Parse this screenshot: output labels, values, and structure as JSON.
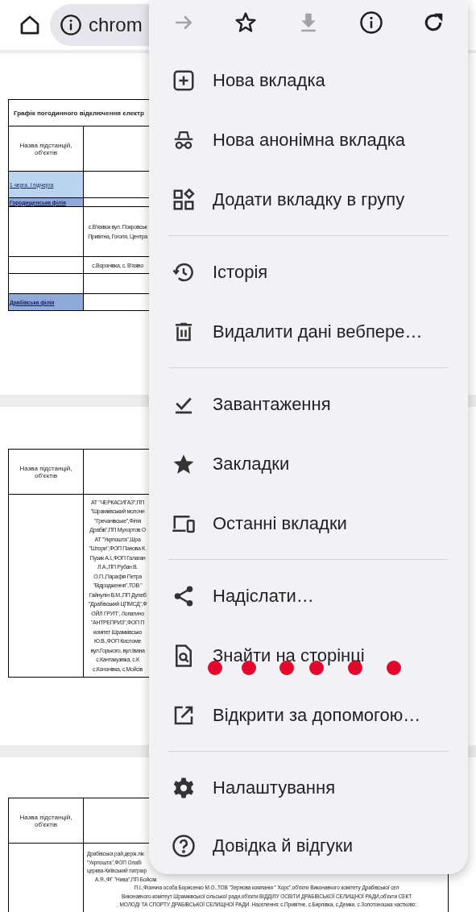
{
  "toolbar": {
    "address": "chrom"
  },
  "pages": [
    {
      "title": "Графік погодинного відключення електр",
      "header": "Назва підстанцій, об'єктів",
      "rows": [
        {
          "kind": "group",
          "label": "1 черга. І підчерга",
          "lines": []
        },
        {
          "kind": "branch",
          "label": "Городищенська філія",
          "lines": []
        },
        {
          "kind": "plain",
          "label": "",
          "lines": [
            "с.В'язівок вул. Покровськ",
            "Привітна, Гоголя, Центра"
          ]
        },
        {
          "kind": "plain",
          "label": "",
          "lines": [
            "с.Воронівка, с. В'язіво"
          ]
        },
        {
          "kind": "plain",
          "label": "",
          "lines": []
        },
        {
          "kind": "branch",
          "label": "Драбівська філія",
          "lines": []
        }
      ]
    },
    {
      "header": "Назва підстанцій, об'єктів",
      "rows": [
        {
          "kind": "plain",
          "label": "",
          "lines": [
            "АТ \"ЧЕРКАСИГАЗ\",ПП",
            "\"Шрамківський молочн",
            "\"Гречанівське\",Філія",
            "Драбів\",ПП Мухортов О",
            "АТ \"Укрпошта\",Шра",
            "\"Штори\",ФОП Панова К.",
            "Пузик А.І.,ФОП Галаган",
            "Л.А.,ПП Рубан В.",
            "О.П.,Парафія Петра",
            "\"Відродження\",ТОВ \"",
            "Гайнулін В.М.,ПП Дулеб",
            "\"Драбівський ЦПМСД\",Ф",
            "ОЙЛ ГРУП\", Лопатино",
            "\"АНТРЕПРИЗ\",ФОП П",
            "комітет Шрамківсько",
            "Ю.В.,ФОП Кисломе",
            "вул.Горького, вул.Івана",
            "с.Кантакузівка, с.К",
            "с.Кононівка, с.Мойсів"
          ]
        }
      ]
    },
    {
      "header": "Назва підстанцій, об'єктів",
      "rows": [
        {
          "kind": "wide",
          "label": "",
          "lines": [
            "Драбівська рай.держ.лік",
            "\"Укрпошта\",ФОП Олабі",
            "церква-Київський патріар",
            "А.Я.,ФГ \"Нива\",ПП Бойсак",
            "П.І.,Фізична особа Борисенко М.О.,ТОВ \"Зернова компанія \" Хорс\",об'єкти Виконавчого комітету Драбівської сел",
            "Виконавчого комітеут Шрамківської сільської ради,об'єкти ВІДДІЛУ ОСВІТИ ДРАБІВСЬКОЇ СЕЛИЩНОЇ РАДИ,об'єкти СЕКТ",
            ", МОЛОДІ ТА СПОРТУ ДРАБІВСЬКОЇ СЕЛИЩНОЇ РАДИ. Населення: с.Привітне, с.Бирлівка, с.Демки, с.Золотоношка частково:"
          ]
        }
      ]
    }
  ],
  "menu": {
    "top_icons": [
      {
        "kind": "forward",
        "disabled": true
      },
      {
        "kind": "star",
        "disabled": false
      },
      {
        "kind": "download",
        "disabled": true
      },
      {
        "kind": "info",
        "disabled": false
      },
      {
        "kind": "reload",
        "disabled": false
      }
    ],
    "sections": [
      [
        {
          "kind": "new-tab",
          "label": "Нова вкладка"
        },
        {
          "kind": "incognito",
          "label": "Нова анонімна вкладка"
        },
        {
          "kind": "group",
          "label": "Додати вкладку в групу"
        }
      ],
      [
        {
          "kind": "history",
          "label": "Історія"
        },
        {
          "kind": "trash",
          "label": "Видалити дані вебпере…"
        }
      ],
      [
        {
          "kind": "downloads",
          "label": "Завантаження"
        },
        {
          "kind": "bookmark",
          "label": "Закладки"
        },
        {
          "kind": "devices",
          "label": "Останні вкладки"
        }
      ],
      [
        {
          "kind": "share",
          "label": "Надіслати…"
        },
        {
          "kind": "find",
          "label": "Знайти на сторінці"
        },
        {
          "kind": "open-with",
          "label": "Відкрити за допомогою…"
        }
      ],
      [
        {
          "kind": "settings",
          "label": "Налаштування"
        },
        {
          "kind": "help",
          "label": "Довідка й відгуки"
        }
      ]
    ]
  }
}
